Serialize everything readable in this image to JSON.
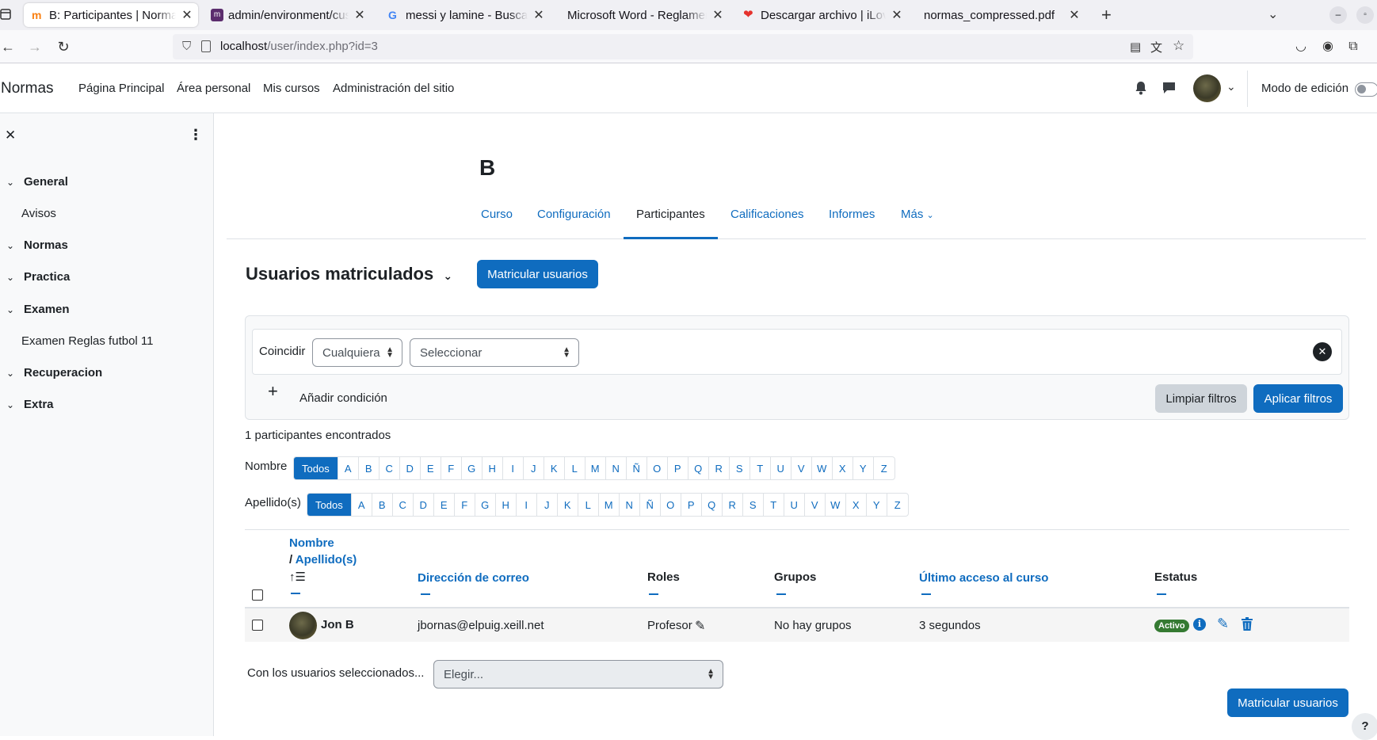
{
  "browser": {
    "tabs": [
      {
        "title": "B: Participantes | Normas",
        "active": true,
        "icon": "moodle-icon"
      },
      {
        "title": "admin/environment/custom",
        "icon": "moodle-icon"
      },
      {
        "title": "messi y lamine - Buscar con Google",
        "icon": "google-icon"
      },
      {
        "title": "Microsoft Word - Reglamento",
        "icon": "none"
      },
      {
        "title": "Descargar archivo | iLovePDF",
        "icon": "ilovepdf-icon"
      },
      {
        "title": "normas_compressed.pdf",
        "icon": "none"
      }
    ],
    "url_host": "localhost",
    "url_path": "/user/index.php?id=3"
  },
  "header": {
    "brand": "Normas",
    "nav": [
      "Página Principal",
      "Área personal",
      "Mis cursos",
      "Administración del sitio"
    ],
    "edit_mode_label": "Modo de edición"
  },
  "drawer": {
    "sections": [
      {
        "label": "General",
        "items": [
          "Avisos"
        ]
      },
      {
        "label": "Normas",
        "items": []
      },
      {
        "label": "Practica",
        "items": []
      },
      {
        "label": "Examen",
        "items": [
          "Examen Reglas futbol 11"
        ]
      },
      {
        "label": "Recuperacion",
        "items": []
      },
      {
        "label": "Extra",
        "items": []
      }
    ]
  },
  "course": {
    "title": "B",
    "tabs": [
      "Curso",
      "Configuración",
      "Participantes",
      "Calificaciones",
      "Informes",
      "Más"
    ],
    "active_tab": "Participantes"
  },
  "page": {
    "heading": "Usuarios matriculados",
    "enrol_button": "Matricular usuarios"
  },
  "filters": {
    "match_label": "Coincidir",
    "match_value": "Cualquiera",
    "select_placeholder": "Seleccionar",
    "add_condition": "Añadir condición",
    "clear": "Limpiar filtros",
    "apply": "Aplicar filtros"
  },
  "results": {
    "count_text": "1 participantes encontrados",
    "first_name_label": "Nombre",
    "last_name_label": "Apellido(s)",
    "all_label": "Todos",
    "letters": [
      "A",
      "B",
      "C",
      "D",
      "E",
      "F",
      "G",
      "H",
      "I",
      "J",
      "K",
      "L",
      "M",
      "N",
      "Ñ",
      "O",
      "P",
      "Q",
      "R",
      "S",
      "T",
      "U",
      "V",
      "W",
      "X",
      "Y",
      "Z"
    ]
  },
  "table": {
    "headers": {
      "name": "Nombre",
      "surname": "Apellido(s)",
      "email": "Dirección de correo",
      "roles": "Roles",
      "groups": "Grupos",
      "last_access": "Último acceso al curso",
      "status": "Estatus"
    },
    "rows": [
      {
        "name": "Jon B",
        "email": "jbornas@elpuig.xeill.net",
        "role": "Profesor",
        "groups": "No hay grupos",
        "last_access": "3 segundos",
        "status": "Activo"
      }
    ]
  },
  "bulk": {
    "label": "Con los usuarios seleccionados...",
    "placeholder": "Elegir..."
  },
  "colors": {
    "primary": "#0f6cbf",
    "success": "#357a32"
  }
}
